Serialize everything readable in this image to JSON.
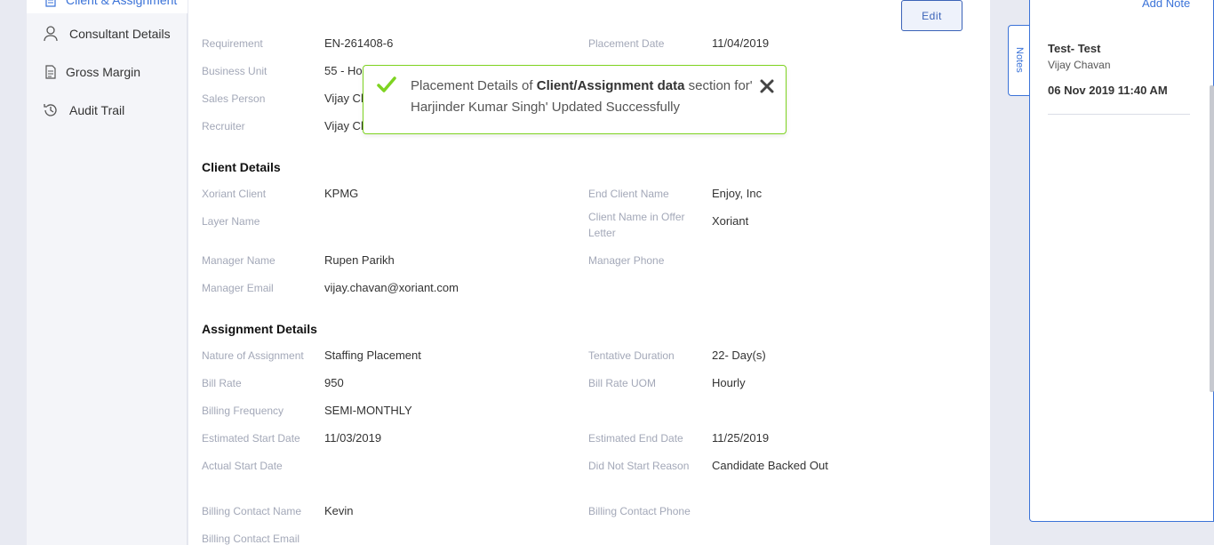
{
  "sidebar": {
    "items": [
      {
        "label": "Client & Assignment",
        "icon": "document-icon"
      },
      {
        "label": "Consultant Details",
        "icon": "user-icon"
      },
      {
        "label": "Gross Margin",
        "icon": "document-icon"
      },
      {
        "label": "Audit Trail",
        "icon": "history-icon"
      }
    ]
  },
  "main": {
    "edit_label": "Edit",
    "placement": {
      "requirement_label": "Requirement",
      "requirement_value": "EN-261408-6",
      "placement_date_label": "Placement Date",
      "placement_date_value": "11/04/2019",
      "business_unit_label": "Business Unit",
      "business_unit_value": "55 - Ho",
      "sales_person_label": "Sales Person",
      "sales_person_value": "Vijay Ch",
      "recruiter_label": "Recruiter",
      "recruiter_value": "Vijay Ch"
    },
    "client_details": {
      "title": "Client Details",
      "xoriant_client_label": "Xoriant Client",
      "xoriant_client_value": "KPMG",
      "end_client_label": "End Client Name",
      "end_client_value": "Enjoy, Inc",
      "layer_name_label": "Layer Name",
      "client_name_offer_label": "Client Name in Offer Letter",
      "client_name_offer_value": "Xoriant",
      "manager_name_label": "Manager Name",
      "manager_name_value": "Rupen Parikh",
      "manager_phone_label": "Manager Phone",
      "manager_email_label": "Manager Email",
      "manager_email_value": "vijay.chavan@xoriant.com"
    },
    "assignment_details": {
      "title": "Assignment Details",
      "nature_label": "Nature of Assignment",
      "nature_value": "Staffing Placement",
      "duration_label": "Tentative Duration",
      "duration_value": "22- Day(s)",
      "bill_rate_label": "Bill Rate",
      "bill_rate_value": "950",
      "bill_rate_uom_label": "Bill Rate UOM",
      "bill_rate_uom_value": "Hourly",
      "billing_frequency_label": "Billing Frequency",
      "billing_frequency_value": "SEMI-MONTHLY",
      "est_start_label": "Estimated Start Date",
      "est_start_value": "11/03/2019",
      "est_end_label": "Estimated End Date",
      "est_end_value": "11/25/2019",
      "actual_start_label": "Actual Start Date",
      "did_not_start_label": "Did Not Start Reason",
      "did_not_start_value": "Candidate Backed Out",
      "billing_contact_name_label": "Billing Contact Name",
      "billing_contact_name_value": "Kevin",
      "billing_contact_phone_label": "Billing Contact Phone",
      "billing_contact_email_label": "Billing Contact Email"
    }
  },
  "toast": {
    "text_part1": "Placement Details of ",
    "text_bold": "Client/Assignment data",
    "text_part2": " section for' Harjinder Kumar Singh' Updated Successfully",
    "color": "#7ed321"
  },
  "notes": {
    "tab_label": "Notes",
    "add_note_label": "Add Note",
    "items": [
      {
        "title": "Test- Test",
        "author": "Vijay Chavan",
        "date": "06 Nov 2019 11:40 AM"
      }
    ]
  },
  "colors": {
    "accent": "#3b73d8",
    "success": "#7ed321"
  }
}
